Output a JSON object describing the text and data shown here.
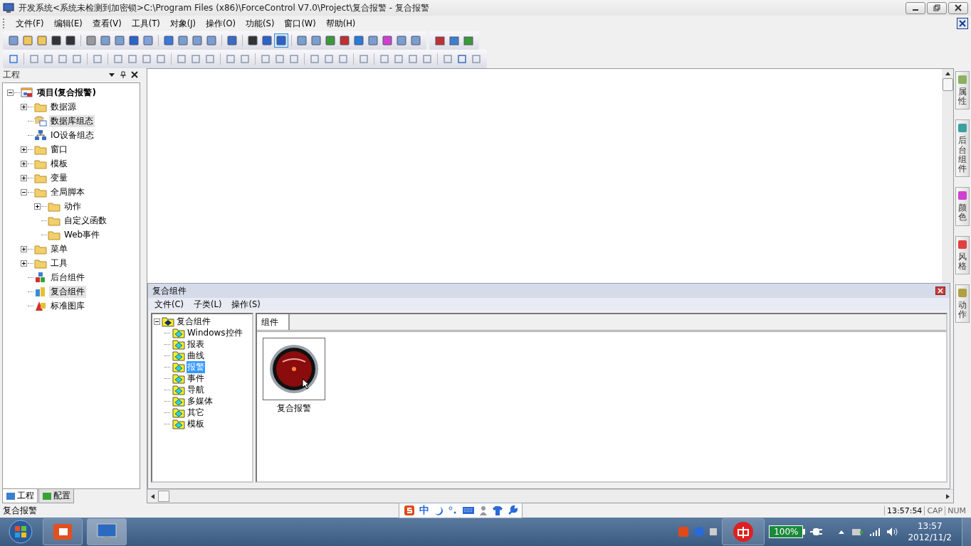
{
  "window": {
    "title": "开发系统<系统未检测到加密锁>C:\\Program Files (x86)\\ForceControl V7.0\\Project\\复合报警 - 复合报警"
  },
  "menu": [
    {
      "label": "文件(F)"
    },
    {
      "label": "编辑(E)"
    },
    {
      "label": "查看(V)"
    },
    {
      "label": "工具(T)"
    },
    {
      "label": "对象(J)"
    },
    {
      "label": "操作(O)"
    },
    {
      "label": "功能(S)"
    },
    {
      "label": "窗口(W)"
    },
    {
      "label": "帮助(H)"
    }
  ],
  "project_panel": {
    "title": "工程",
    "tree": [
      {
        "label": "项目(复合报警)",
        "kind": "project",
        "expanded": true,
        "selected": false,
        "children": [
          {
            "label": "数据源",
            "kind": "folder",
            "expanded": false,
            "selected": false
          },
          {
            "label": "数据库组态",
            "kind": "database",
            "selected": true
          },
          {
            "label": "IO设备组态",
            "kind": "network",
            "selected": false
          },
          {
            "label": "窗口",
            "kind": "folder",
            "expanded": false,
            "selected": false
          },
          {
            "label": "模板",
            "kind": "folder",
            "expanded": false,
            "selected": false
          },
          {
            "label": "变量",
            "kind": "folder",
            "expanded": false,
            "selected": false
          },
          {
            "label": "全局脚本",
            "kind": "folder",
            "expanded": true,
            "selected": false,
            "children": [
              {
                "label": "动作",
                "kind": "folder",
                "expanded": false,
                "selected": false
              },
              {
                "label": "自定义函数",
                "kind": "folder",
                "selected": false
              },
              {
                "label": "Web事件",
                "kind": "folder",
                "selected": false
              }
            ]
          },
          {
            "label": "菜单",
            "kind": "folder",
            "expanded": false,
            "selected": false
          },
          {
            "label": "工具",
            "kind": "folder",
            "expanded": false,
            "selected": false
          },
          {
            "label": "后台组件",
            "kind": "blocks",
            "selected": false
          },
          {
            "label": "复合组件",
            "kind": "component",
            "selected": true
          },
          {
            "label": "标准图库",
            "kind": "library",
            "selected": false
          }
        ]
      }
    ],
    "tabs": [
      {
        "label": "工程",
        "selected": true
      },
      {
        "label": "配置",
        "selected": false
      }
    ]
  },
  "side_tabs": [
    {
      "label": "属性"
    },
    {
      "label": "后台组件"
    },
    {
      "label": "颜色"
    },
    {
      "label": "风格"
    },
    {
      "label": "动作"
    }
  ],
  "component_panel": {
    "title": "复合组件",
    "menu": [
      {
        "label": "文件(C)"
      },
      {
        "label": "子类(L)"
      },
      {
        "label": "操作(S)"
      }
    ],
    "tree": {
      "label": "复合组件",
      "expanded": true,
      "children": [
        {
          "label": "Windows控件",
          "selected": false
        },
        {
          "label": "报表",
          "selected": false
        },
        {
          "label": "曲线",
          "selected": false
        },
        {
          "label": "报警",
          "selected": true
        },
        {
          "label": "事件",
          "selected": false
        },
        {
          "label": "导航",
          "selected": false
        },
        {
          "label": "多媒体",
          "selected": false
        },
        {
          "label": "其它",
          "selected": false
        },
        {
          "label": "模板",
          "selected": false
        }
      ]
    },
    "tabs": [
      {
        "label": "组件"
      }
    ],
    "items": [
      {
        "label": "复合报警"
      }
    ]
  },
  "ime_bar": {
    "mode": "中"
  },
  "status_bar": {
    "message": "复合报警",
    "time": "13:57:54",
    "caps": "CAP",
    "num": "NUM"
  },
  "taskbar": {
    "battery": "100%",
    "clock_time": "13:57",
    "clock_date": "2012/11/2"
  }
}
